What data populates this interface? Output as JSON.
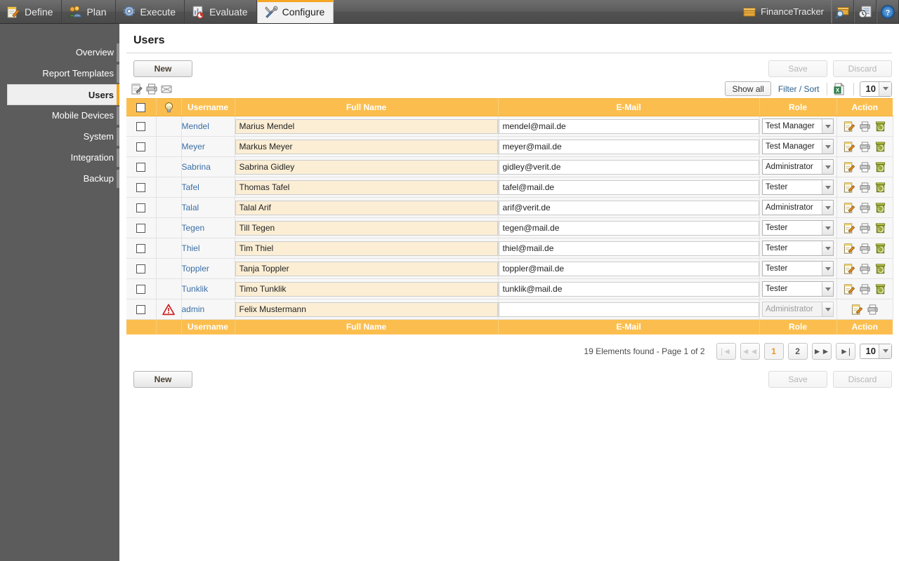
{
  "topnav": {
    "tabs": [
      {
        "label": "Define",
        "icon": "notepad-pencil-icon",
        "active": false
      },
      {
        "label": "Plan",
        "icon": "people-icon",
        "active": false
      },
      {
        "label": "Execute",
        "icon": "gear-icon",
        "active": false
      },
      {
        "label": "Evaluate",
        "icon": "chart-report-icon",
        "active": false
      },
      {
        "label": "Configure",
        "icon": "tools-icon",
        "active": true
      }
    ],
    "project": {
      "label": "FinanceTracker",
      "icon": "box-icon"
    },
    "buttons": [
      {
        "name": "project-search-icon",
        "icon": "box-search-icon"
      },
      {
        "name": "history-icon",
        "icon": "document-clock-icon"
      },
      {
        "name": "help-icon",
        "icon": "question-circle-icon"
      }
    ]
  },
  "sidebar": {
    "items": [
      {
        "label": "Overview",
        "active": false
      },
      {
        "label": "Report Templates",
        "active": false
      },
      {
        "label": "Users",
        "active": true
      },
      {
        "label": "Mobile Devices",
        "active": false
      },
      {
        "label": "System",
        "active": false
      },
      {
        "label": "Integration",
        "active": false
      },
      {
        "label": "Backup",
        "active": false
      }
    ]
  },
  "page": {
    "title": "Users",
    "new_label": "New",
    "save_label": "Save",
    "discard_label": "Discard",
    "show_all_label": "Show all",
    "filter_sort_label": "Filter / Sort",
    "page_size": "10",
    "tool_icons": [
      "edit-notepad-icon",
      "printer-icon",
      "envelope-icon"
    ],
    "export_icon": "excel-export-icon"
  },
  "table": {
    "columns": [
      "",
      "",
      "Username",
      "Full Name",
      "E-Mail",
      "Role",
      "Action"
    ],
    "header_flag_icon": "lightbulb-icon",
    "select_all_checkbox": false,
    "rows": [
      {
        "checked": false,
        "flag": "",
        "username": "Mendel",
        "fullname": "Marius Mendel",
        "email": "mendel@mail.de",
        "role": "Test Manager",
        "role_disabled": false,
        "actions": [
          "edit-icon",
          "print-icon",
          "delete-icon"
        ]
      },
      {
        "checked": false,
        "flag": "",
        "username": "Meyer",
        "fullname": "Markus Meyer",
        "email": "meyer@mail.de",
        "role": "Test Manager",
        "role_disabled": false,
        "actions": [
          "edit-icon",
          "print-icon",
          "delete-icon"
        ]
      },
      {
        "checked": false,
        "flag": "",
        "username": "Sabrina",
        "fullname": "Sabrina Gidley",
        "email": "gidley@verit.de",
        "role": "Administrator",
        "role_disabled": false,
        "actions": [
          "edit-icon",
          "print-icon",
          "delete-icon"
        ]
      },
      {
        "checked": false,
        "flag": "",
        "username": "Tafel",
        "fullname": "Thomas Tafel",
        "email": "tafel@mail.de",
        "role": "Tester",
        "role_disabled": false,
        "actions": [
          "edit-icon",
          "print-icon",
          "delete-icon"
        ]
      },
      {
        "checked": false,
        "flag": "",
        "username": "Talal",
        "fullname": "Talal Arif",
        "email": "arif@verit.de",
        "role": "Administrator",
        "role_disabled": false,
        "actions": [
          "edit-icon",
          "print-icon",
          "delete-icon"
        ]
      },
      {
        "checked": false,
        "flag": "",
        "username": "Tegen",
        "fullname": "Till Tegen",
        "email": "tegen@mail.de",
        "role": "Tester",
        "role_disabled": false,
        "actions": [
          "edit-icon",
          "print-icon",
          "delete-icon"
        ]
      },
      {
        "checked": false,
        "flag": "",
        "username": "Thiel",
        "fullname": "Tim Thiel",
        "email": "thiel@mail.de",
        "role": "Tester",
        "role_disabled": false,
        "actions": [
          "edit-icon",
          "print-icon",
          "delete-icon"
        ]
      },
      {
        "checked": false,
        "flag": "",
        "username": "Toppler",
        "fullname": "Tanja Toppler",
        "email": "toppler@mail.de",
        "role": "Tester",
        "role_disabled": false,
        "actions": [
          "edit-icon",
          "print-icon",
          "delete-icon"
        ]
      },
      {
        "checked": false,
        "flag": "",
        "username": "Tunklik",
        "fullname": "Timo Tunklik",
        "email": "tunklik@mail.de",
        "role": "Tester",
        "role_disabled": false,
        "actions": [
          "edit-icon",
          "print-icon",
          "delete-icon"
        ]
      },
      {
        "checked": false,
        "flag": "warning-icon",
        "username": "admin",
        "fullname": "Felix Mustermann",
        "email": "",
        "role": "Administrator",
        "role_disabled": true,
        "actions": [
          "edit-icon",
          "print-icon"
        ]
      }
    ]
  },
  "pagination": {
    "info": "19 Elements found - Page 1 of 2",
    "first_label": "|◄",
    "prev_label": "◄◄",
    "pages": [
      "1",
      "2"
    ],
    "current_page": "1",
    "next_label": "►►",
    "last_label": "►|",
    "page_size": "10"
  },
  "colors": {
    "accent": "#fbbe4e",
    "header_orange": "#f0931e",
    "topbar_grey": "#5c5c5c",
    "row_input_cream": "#fbeed5"
  }
}
